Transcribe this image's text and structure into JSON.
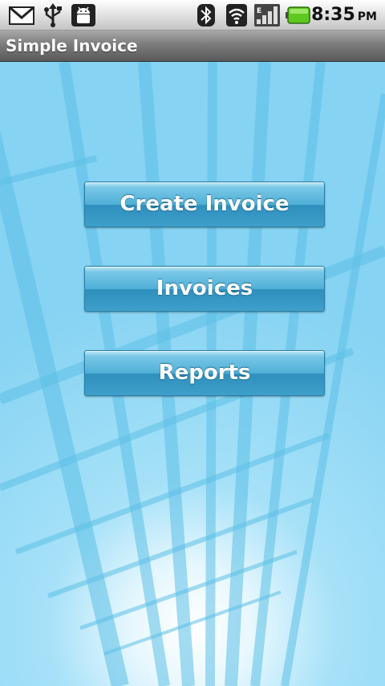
{
  "status_bar": {
    "time": "8:35",
    "ampm": "PM",
    "icons": [
      "gmail-icon",
      "usb-icon",
      "android-debug-icon",
      "bluetooth-icon",
      "wifi-icon",
      "signal-icon",
      "battery-icon"
    ],
    "battery_color": "#5fc81e"
  },
  "app": {
    "title": "Simple Invoice"
  },
  "menu": {
    "create_invoice_label": "Create Invoice",
    "invoices_label": "Invoices",
    "reports_label": "Reports"
  },
  "colors": {
    "background": "#8ed6f4",
    "button": "#4fb0d8",
    "title_bar": "#7c7c7c"
  }
}
